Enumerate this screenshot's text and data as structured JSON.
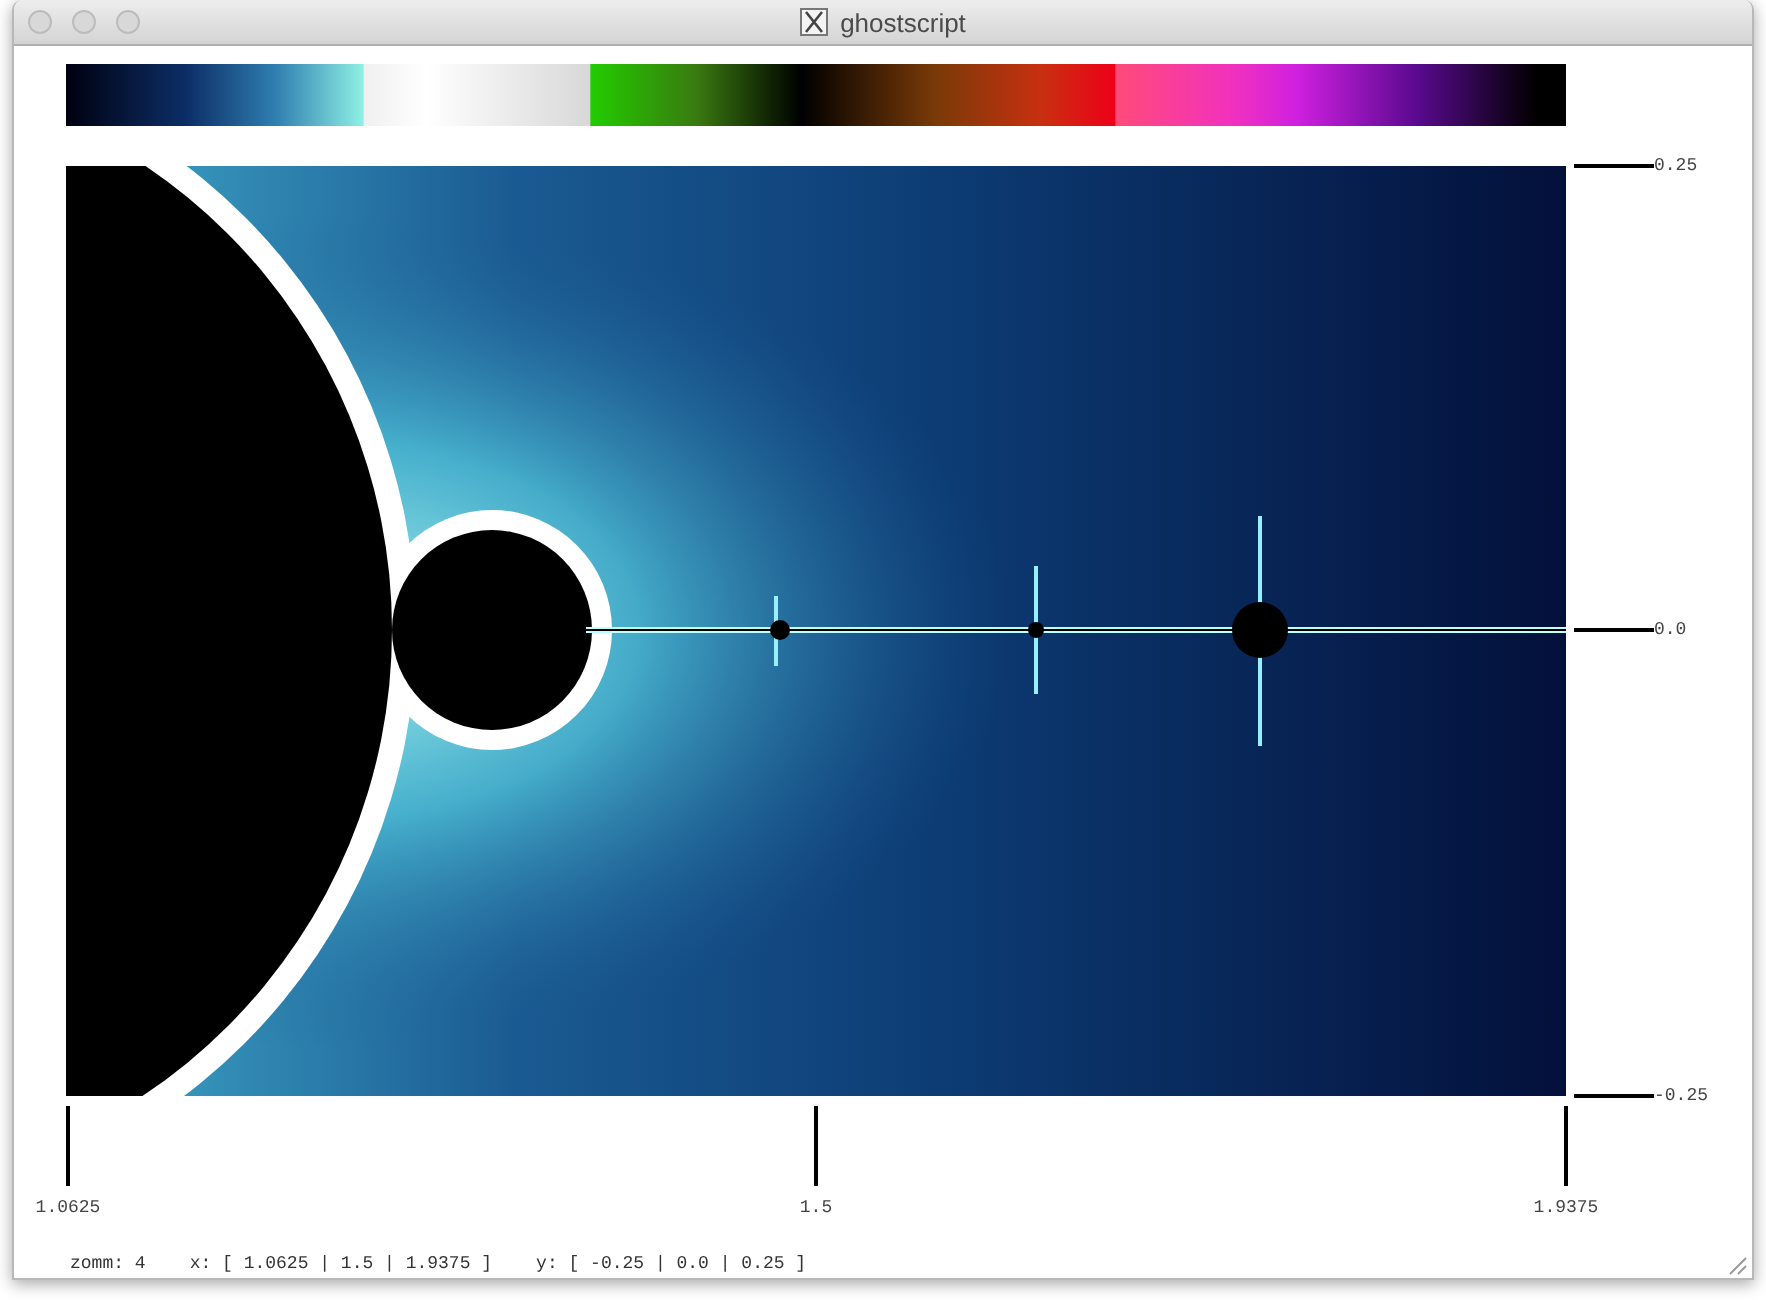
{
  "window": {
    "title": "ghostscript"
  },
  "y_axis": {
    "labels": [
      "0.25",
      "0.0",
      "-0.25"
    ]
  },
  "x_axis": {
    "labels": [
      "1.0625",
      "1.5",
      "1.9375"
    ]
  },
  "status_bar": {
    "zoom": "zomm: 4",
    "x_range": "x: [ 1.0625 | 1.5 | 1.9375 ]",
    "y_range": "y: [ -0.25 | 0.0 | 0.25 ]"
  }
}
